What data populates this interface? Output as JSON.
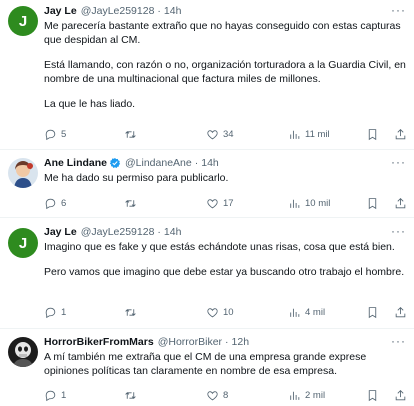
{
  "tweets": [
    {
      "avatar_letter": "J",
      "name": "Jay Le",
      "handle": "@JayLe259128",
      "time": "14h",
      "paragraphs": [
        "Me parecería bastante extraño que no hayas conseguido con estas capturas que despidan al CM.",
        "Está llamando, con razón o no, organización torturadora a la Guardia Civil, en nombre de una multinacional que factura miles de millones.",
        "La que le has liado."
      ],
      "replies": "5",
      "retweets": "",
      "likes": "34",
      "views": "11 mil"
    },
    {
      "name": "Ane Lindane",
      "handle": "@LindaneAne",
      "time": "14h",
      "paragraphs": [
        "Me ha dado su permiso para publicarlo."
      ],
      "replies": "6",
      "retweets": "",
      "likes": "17",
      "views": "10 mil"
    },
    {
      "avatar_letter": "J",
      "name": "Jay Le",
      "handle": "@JayLe259128",
      "time": "14h",
      "paragraphs": [
        "Imagino que es fake y que estás echándote unas risas, cosa que está bien.",
        "Pero vamos que imagino que debe estar ya buscando otro trabajo el hombre."
      ],
      "replies": "1",
      "retweets": "",
      "likes": "10",
      "views": "4 mil"
    },
    {
      "name": "HorrorBikerFromMars",
      "handle": "@HorrorBiker",
      "time": "12h",
      "paragraphs": [
        "A mí también me extraña que el CM de una empresa grande exprese opiniones políticas tan claramente en nombre de esa empresa."
      ],
      "replies": "1",
      "retweets": "",
      "likes": "8",
      "views": "2 mil"
    }
  ],
  "separator": "·",
  "more_label": "···",
  "colors": {
    "accent": "#1d9bf0",
    "muted": "#536471",
    "text": "#0f1419",
    "avatar_green": "#2e8b1f"
  }
}
